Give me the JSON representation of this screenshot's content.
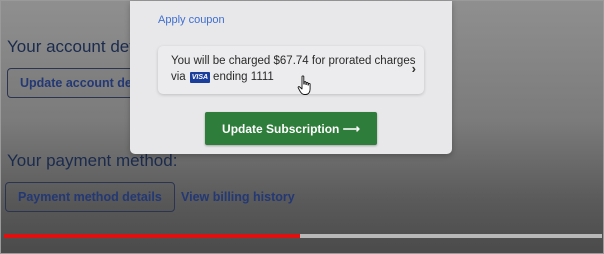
{
  "background": {
    "account_heading": "Your account details",
    "update_account_button": "Update account details",
    "payment_heading": "Your payment method:",
    "payment_method_button": "Payment method details",
    "billing_history_link": "View billing history"
  },
  "modal": {
    "apply_coupon": "Apply coupon",
    "charge_prefix": "You will be charged",
    "charge_amount": "$67.74",
    "charge_suffix": "for prorated charges",
    "via_label": "via",
    "card_brand": "VISA",
    "ending_label": "ending 1111",
    "chevron": "›",
    "update_button": "Update Subscription ⟶"
  },
  "video": {
    "progress_fraction": 0.495,
    "progress_color": "#e01010"
  },
  "colors": {
    "primary_button": "#2e7d3a",
    "link": "#3f6fd0",
    "brand_navy": "#233874"
  },
  "icons": {
    "cursor": "hand-pointer-icon",
    "chevron": "chevron-right-icon",
    "card": "visa-card-icon"
  }
}
